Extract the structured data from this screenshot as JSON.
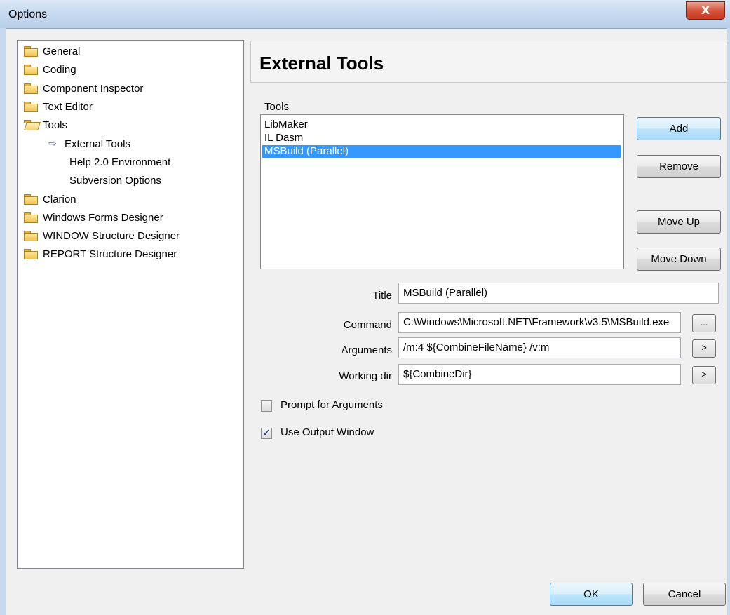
{
  "window": {
    "title": "Options",
    "close_glyph": "X"
  },
  "tree": {
    "items": [
      {
        "label": "General",
        "icon": "folder-icon"
      },
      {
        "label": "Coding",
        "icon": "folder-icon"
      },
      {
        "label": "Component Inspector",
        "icon": "folder-icon"
      },
      {
        "label": "Text Editor",
        "icon": "folder-icon"
      },
      {
        "label": "Tools",
        "icon": "folder-open-icon"
      },
      {
        "label": "External Tools",
        "icon": "arrow-right-icon",
        "selected": true
      },
      {
        "label": "Help 2.0 Environment",
        "icon": ""
      },
      {
        "label": "Subversion Options",
        "icon": ""
      },
      {
        "label": "Clarion",
        "icon": "folder-icon"
      },
      {
        "label": "Windows Forms Designer",
        "icon": "folder-icon"
      },
      {
        "label": "WINDOW Structure Designer",
        "icon": "folder-icon"
      },
      {
        "label": "REPORT Structure Designer",
        "icon": "folder-icon"
      }
    ],
    "arrow_glyph": "⇨"
  },
  "page": {
    "header": "External Tools"
  },
  "tools": {
    "label": "Tools",
    "items": [
      "LibMaker",
      "IL Dasm",
      "MSBuild (Parallel)"
    ],
    "selected": "MSBuild (Parallel)"
  },
  "buttons": {
    "add": "Add",
    "remove": "Remove",
    "move_up": "Move Up",
    "move_down": "Move Down",
    "ok": "OK",
    "cancel": "Cancel",
    "browse": "...",
    "insert": ">"
  },
  "fields": {
    "title_label": "Title",
    "title_value": "MSBuild (Parallel)",
    "command_label": "Command",
    "command_value": "C:\\Windows\\Microsoft.NET\\Framework\\v3.5\\MSBuild.exe",
    "arguments_label": "Arguments",
    "arguments_value": "/m:4 ${CombineFileName}  /v:m",
    "workdir_label": "Working dir",
    "workdir_value": "${CombineDir}"
  },
  "options": {
    "prompt_label": "Prompt for Arguments",
    "prompt_checked": false,
    "output_label": "Use Output Window",
    "output_checked": true,
    "check_glyph": "✓"
  },
  "colors": {
    "selection": "#3399ff",
    "titlebar": "#c6d9ef"
  }
}
